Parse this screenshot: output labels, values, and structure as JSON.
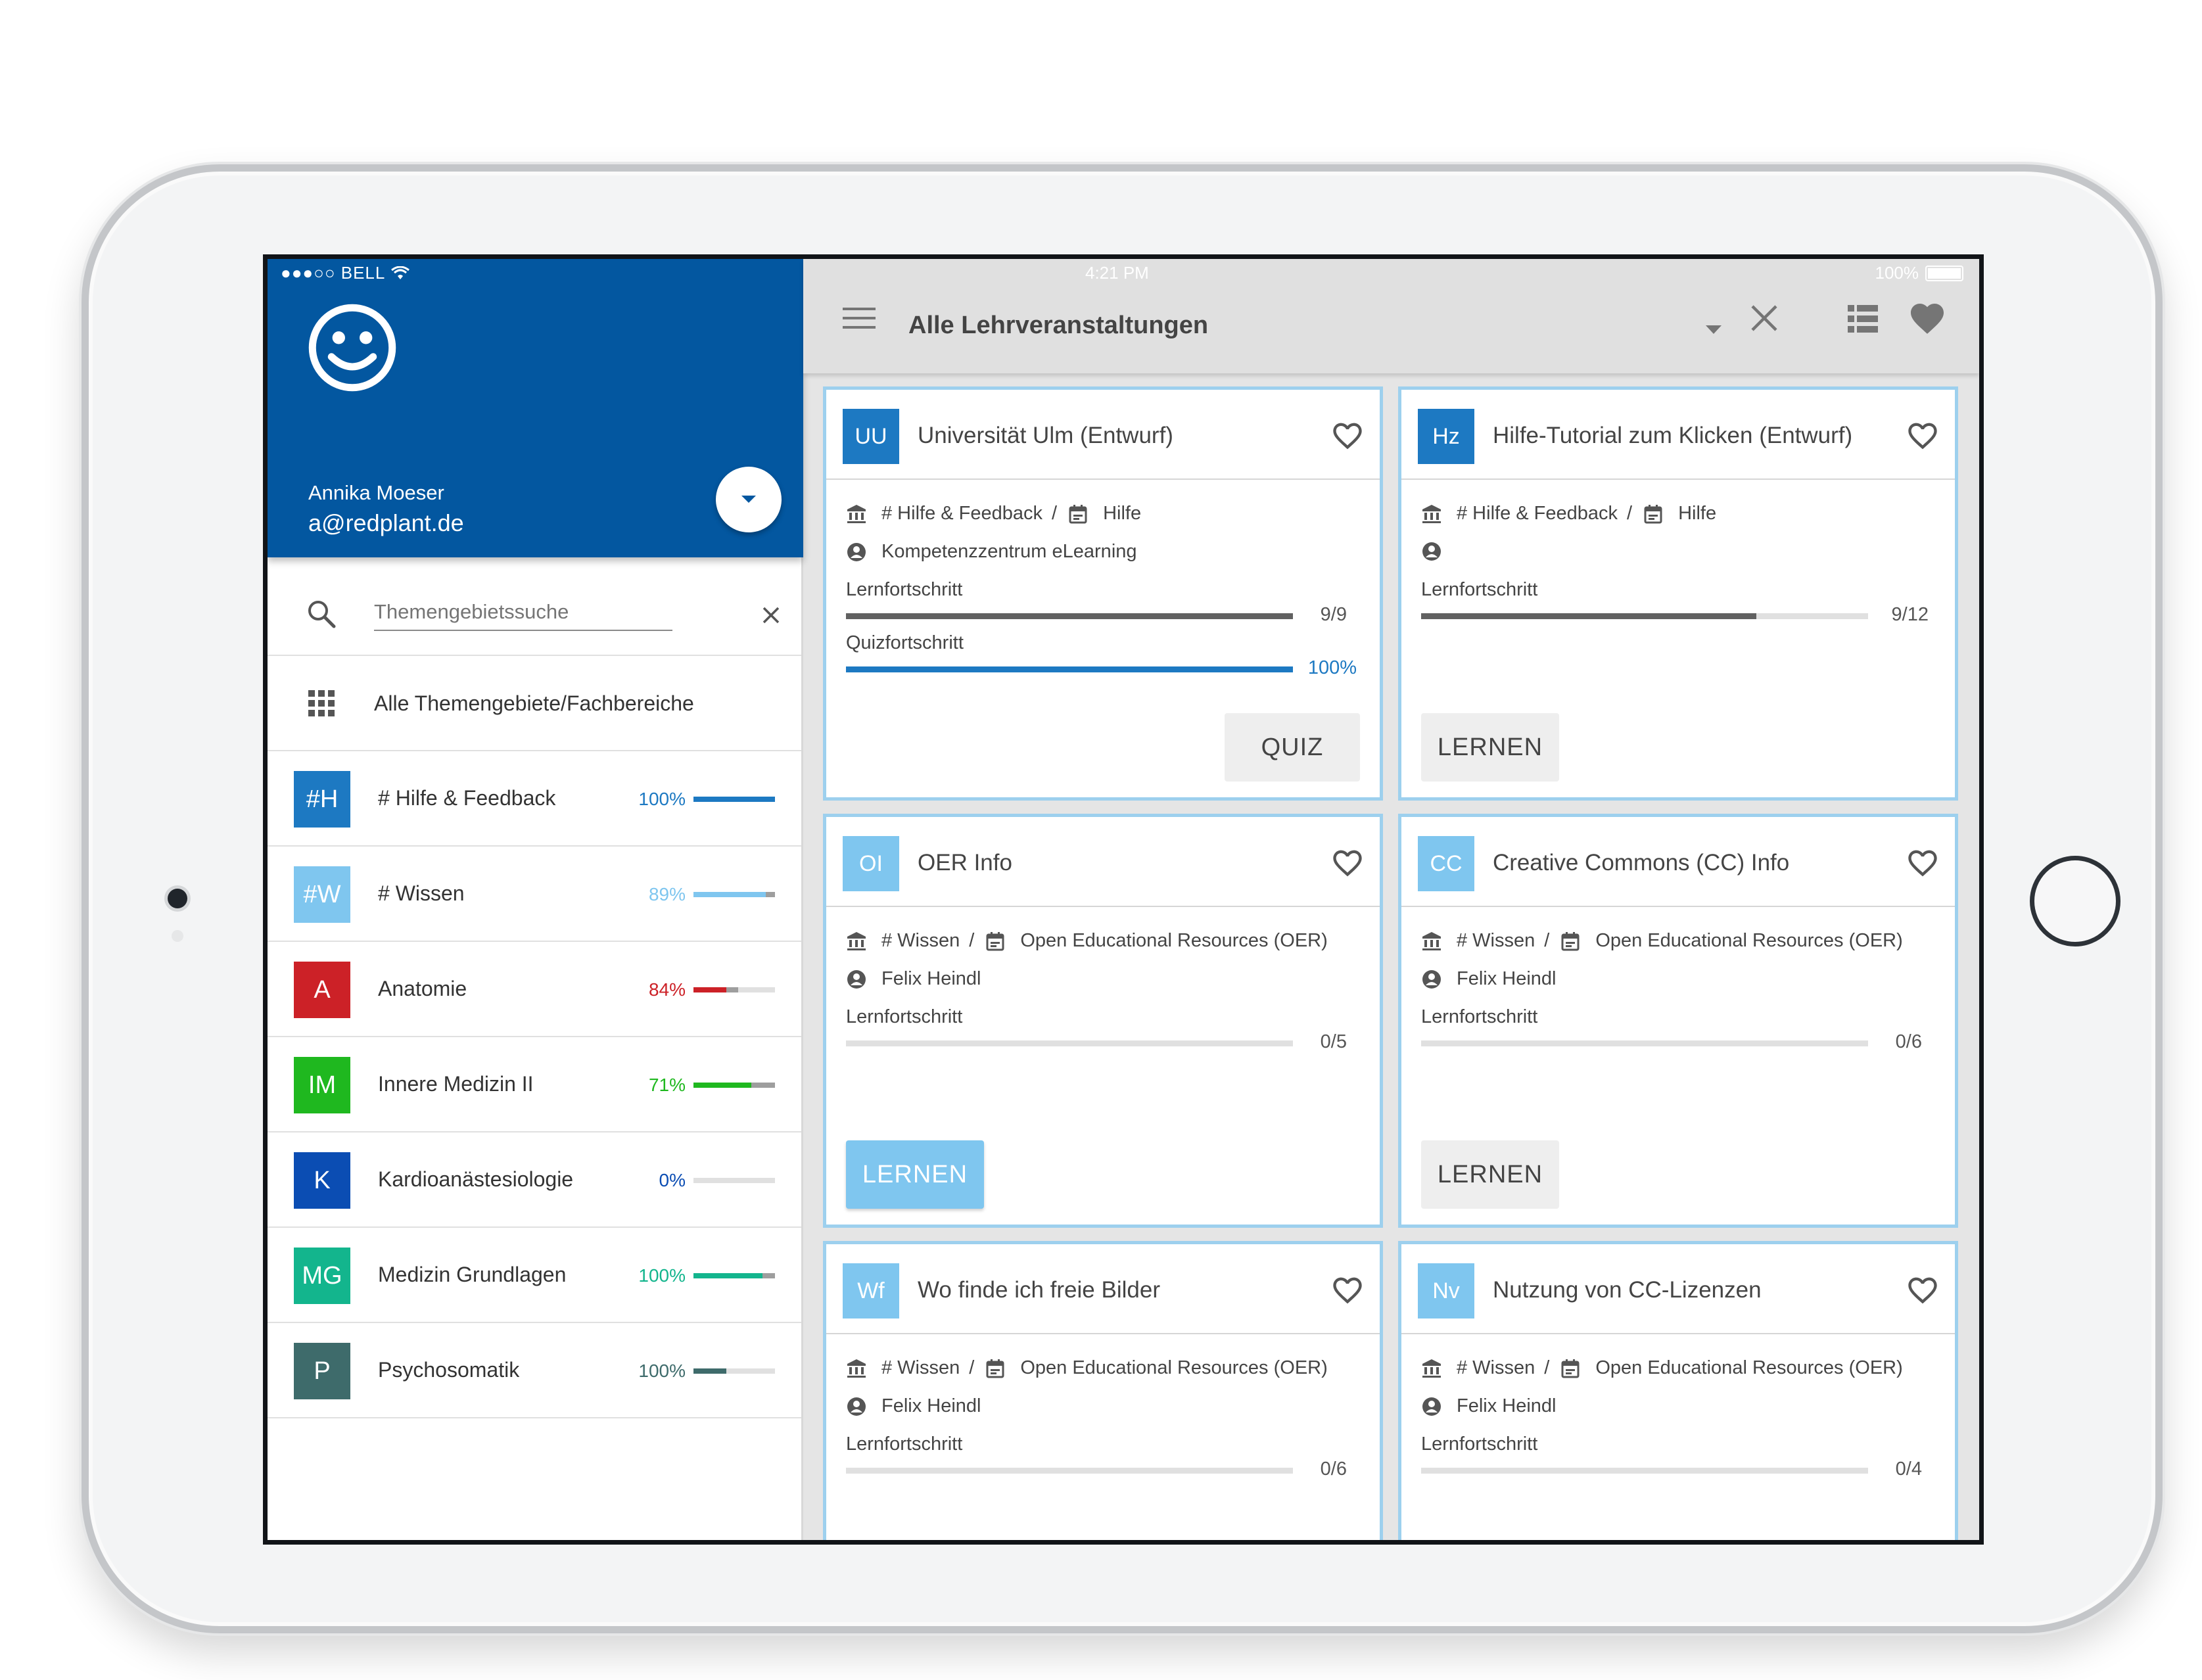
{
  "status_bar": {
    "carrier": "●●●○○ BELL",
    "time": "4:21 PM",
    "battery": "100%"
  },
  "user": {
    "name": "Annika Moeser",
    "email": "a@redplant.de"
  },
  "sidebar": {
    "search_placeholder": "Themengebietssuche",
    "all_label": "Alle Themengebiete/Fachbereiche",
    "topics": [
      {
        "badge": "#H",
        "name": "# Hilfe & Feedback",
        "percent": "100%",
        "progress": 1.0,
        "secondary": 1.0,
        "color": "#1d79c2",
        "pct_color": "#1d79c2"
      },
      {
        "badge": "#W",
        "name": "# Wissen",
        "percent": "89%",
        "progress": 0.89,
        "secondary": 1.0,
        "color": "#7fc6ef",
        "pct_color": "#7fc6ef"
      },
      {
        "badge": "A",
        "name": "Anatomie",
        "percent": "84%",
        "progress": 0.4,
        "secondary": 0.55,
        "color": "#cc2127",
        "pct_color": "#cc2127"
      },
      {
        "badge": "IM",
        "name": "Innere Medizin II",
        "percent": "71%",
        "progress": 0.71,
        "secondary": 1.0,
        "color": "#1fb81f",
        "pct_color": "#1fb81f"
      },
      {
        "badge": "K",
        "name": "Kardioanästesiologie",
        "percent": "0%",
        "progress": 0.0,
        "secondary": 0.0,
        "color": "#0b4db3",
        "pct_color": "#0b4db3"
      },
      {
        "badge": "MG",
        "name": "Medizin Grundlagen",
        "percent": "100%",
        "progress": 0.85,
        "secondary": 1.0,
        "color": "#13b58d",
        "pct_color": "#13b58d"
      },
      {
        "badge": "P",
        "name": "Psychosomatik",
        "percent": "100%",
        "progress": 0.4,
        "secondary": 0.4,
        "color": "#3e6b6b",
        "pct_color": "#3e6b6b"
      }
    ]
  },
  "appbar": {
    "title": "Alle Lehrveranstaltungen"
  },
  "cards": [
    {
      "badge": "UU",
      "title": "Universität Ulm (Entwurf)",
      "badge_color": "#1d79c2",
      "active": true,
      "topic": "# Hilfe & Feedback",
      "category": "Hilfe",
      "author": "Kompetenzzentrum eLearning",
      "progress_label": "Lernfortschritt",
      "progress_count": "9/9",
      "progress": 1.0,
      "quiz_label": "Quizfortschritt",
      "quiz_count": "100%",
      "quiz_progress": 1.0,
      "button": "QUIZ",
      "button_style": "flat"
    },
    {
      "badge": "Hz",
      "title": "Hilfe-Tutorial zum Klicken (Entwurf)",
      "badge_color": "#1d79c2",
      "active": true,
      "topic": "# Hilfe & Feedback",
      "category": "Hilfe",
      "author": "",
      "progress_label": "Lernfortschritt",
      "progress_count": "9/12",
      "progress": 0.75,
      "button": "LERNEN",
      "button_style": "flat"
    },
    {
      "badge": "OI",
      "title": "OER Info",
      "badge_color": "#7fc6ef",
      "active": false,
      "topic": "# Wissen",
      "category": "Open Educational Resources (OER)",
      "author": "Felix Heindl",
      "progress_label": "Lernfortschritt",
      "progress_count": "0/5",
      "progress": 0.0,
      "button": "LERNEN",
      "button_style": "primary"
    },
    {
      "badge": "CC",
      "title": "Creative Commons (CC) Info",
      "badge_color": "#7fc6ef",
      "active": false,
      "topic": "# Wissen",
      "category": "Open Educational Resources (OER)",
      "author": "Felix Heindl",
      "progress_label": "Lernfortschritt",
      "progress_count": "0/6",
      "progress": 0.0,
      "button": "LERNEN",
      "button_style": "flat"
    },
    {
      "badge": "Wf",
      "title": "Wo finde ich freie Bilder",
      "badge_color": "#7fc6ef",
      "active": false,
      "topic": "# Wissen",
      "category": "Open Educational Resources (OER)",
      "author": "Felix Heindl",
      "progress_label": "Lernfortschritt",
      "progress_count": "0/6",
      "progress": 0.0
    },
    {
      "badge": "Nv",
      "title": "Nutzung von CC-Lizenzen",
      "badge_color": "#7fc6ef",
      "active": false,
      "topic": "# Wissen",
      "category": "Open Educational Resources (OER)",
      "author": "Felix Heindl",
      "progress_label": "Lernfortschritt",
      "progress_count": "0/4",
      "progress": 0.0
    }
  ],
  "colors": {
    "primary": "#0357a0",
    "accent": "#1d79c2",
    "light_accent": "#7fc6ef",
    "progress_dark": "#616161"
  },
  "icons": [
    "wifi-icon",
    "smiley-icon",
    "chevron-down-icon",
    "search-icon",
    "close-icon",
    "apps-grid-icon",
    "menu-icon",
    "list-view-icon",
    "heart-icon",
    "institution-icon",
    "calendar-icon",
    "account-icon"
  ]
}
